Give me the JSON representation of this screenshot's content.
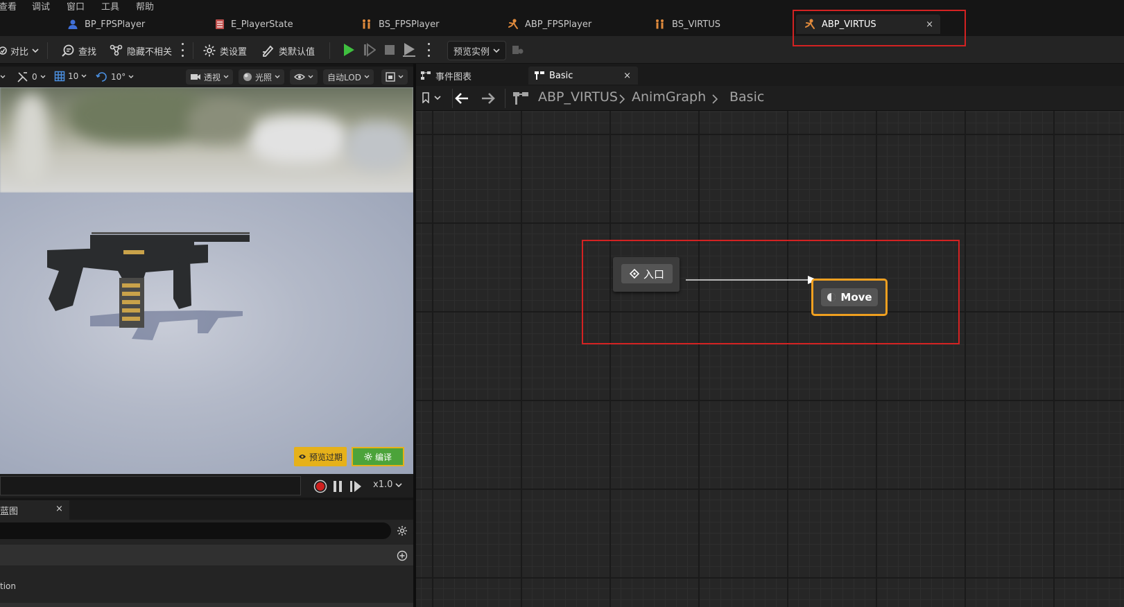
{
  "menu": [
    "查看",
    "调试",
    "窗口",
    "工具",
    "帮助"
  ],
  "tabs": [
    {
      "label": "BP_FPSPlayer",
      "icon": "blueprint-icon"
    },
    {
      "label": "E_PlayerState",
      "icon": "enum-icon"
    },
    {
      "label": "BS_FPSPlayer",
      "icon": "blendspace-icon"
    },
    {
      "label": "ABP_FPSPlayer",
      "icon": "anim-blueprint-icon"
    },
    {
      "label": "BS_VIRTUS",
      "icon": "blendspace-icon"
    },
    {
      "label": "ABP_VIRTUS",
      "icon": "anim-blueprint-icon",
      "active": true,
      "close": "×"
    }
  ],
  "toolbar": {
    "diff": "对比",
    "find": "查找",
    "hide_unrelated": "隐藏不相关",
    "class_settings": "类设置",
    "class_defaults": "类默认值",
    "preview_instance": "预览实例"
  },
  "viewport_toolbar": {
    "angle_snap": "0",
    "grid_snap": "10",
    "rotation_snap": "10°",
    "perspective": "透视",
    "lighting": "光照",
    "lod": "自动LOD"
  },
  "viewport": {
    "expired_label": "预览过期",
    "compile_label": "编译"
  },
  "playback": {
    "speed": "x1.0"
  },
  "bottom_panel": {
    "tab_label": "蓝图",
    "tab_close": "×",
    "row_text": "tion"
  },
  "graph": {
    "tabs": [
      {
        "label": "事件图表"
      },
      {
        "label": "Basic",
        "close": "×",
        "active": true
      }
    ],
    "breadcrumb": [
      "ABP_VIRTUS",
      "AnimGraph",
      "Basic"
    ],
    "entry_node": "入口",
    "state_node": "Move"
  },
  "colors": {
    "highlight_box": "#d42222",
    "node_selected": "#f0a020",
    "compile_green": "#4ca33a",
    "warning_yellow": "#e6b11a",
    "play_green": "#3fbf3f"
  }
}
